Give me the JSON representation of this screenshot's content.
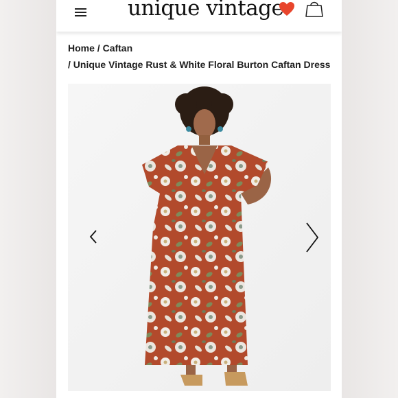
{
  "header": {
    "logo_text": "unique vintage",
    "icons": {
      "menu": "menu-icon",
      "favorites": "heart-icon",
      "cart": "shopping-bag-icon"
    },
    "colors": {
      "heart": "#e8452c",
      "text": "#111111"
    }
  },
  "breadcrumb": {
    "home": "Home",
    "sep1": " / ",
    "category": "Caftan",
    "sep2": "/ ",
    "product": "Unique Vintage Rust & White Floral Burton Caftan Dress"
  },
  "gallery": {
    "prev_icon": "chevron-left-icon",
    "next_icon": "chevron-right-icon",
    "colors": {
      "dress": "#b24a2c",
      "background": "#f4f4f4"
    }
  }
}
